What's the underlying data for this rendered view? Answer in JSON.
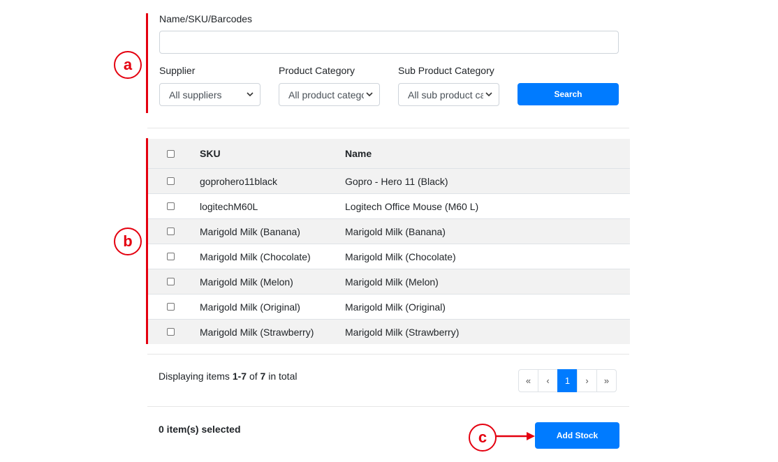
{
  "annotations": {
    "a": "a",
    "b": "b",
    "c": "c"
  },
  "filters": {
    "search_label": "Name/SKU/Barcodes",
    "search_value": "",
    "supplier_label": "Supplier",
    "supplier_value": "All suppliers",
    "category_label": "Product Category",
    "category_value": "All product categories",
    "subcategory_label": "Sub Product Category",
    "subcategory_value": "All sub product categories",
    "search_button": "Search"
  },
  "table": {
    "columns": [
      "SKU",
      "Name"
    ],
    "rows": [
      {
        "sku": "goprohero11black",
        "name": "Gopro - Hero 11 (Black)"
      },
      {
        "sku": "logitechM60L",
        "name": "Logitech Office Mouse (M60 L)"
      },
      {
        "sku": "Marigold Milk (Banana)",
        "name": "Marigold Milk (Banana)"
      },
      {
        "sku": "Marigold Milk (Chocolate)",
        "name": "Marigold Milk (Chocolate)"
      },
      {
        "sku": "Marigold Milk (Melon)",
        "name": "Marigold Milk (Melon)"
      },
      {
        "sku": "Marigold Milk (Original)",
        "name": "Marigold Milk (Original)"
      },
      {
        "sku": "Marigold Milk (Strawberry)",
        "name": "Marigold Milk (Strawberry)"
      }
    ]
  },
  "pagination": {
    "info_prefix": "Displaying items ",
    "info_range": "1-7",
    "info_of": " of ",
    "info_total": "7",
    "info_suffix": " in total",
    "first": "«",
    "prev": "‹",
    "current": "1",
    "next": "›",
    "last": "»"
  },
  "footer": {
    "selected_text": "0 item(s) selected",
    "add_stock_button": "Add Stock"
  },
  "colors": {
    "primary": "#007bff",
    "annotation": "#e4000f"
  }
}
